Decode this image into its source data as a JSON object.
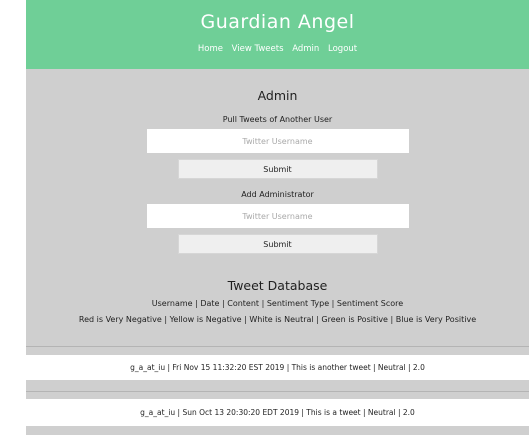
{
  "header": {
    "title": "Guardian Angel",
    "nav": [
      "Home",
      "View Tweets",
      "Admin",
      "Logout"
    ]
  },
  "admin": {
    "title": "Admin",
    "pull": {
      "label": "Pull Tweets of Another User",
      "placeholder": "Twitter Username",
      "submit": "Submit"
    },
    "add": {
      "label": "Add Administrator",
      "placeholder": "Twitter Username",
      "submit": "Submit"
    }
  },
  "database": {
    "title": "Tweet Database",
    "columns": "Username | Date | Content | Sentiment Type | Sentiment Score",
    "legend": "Red is Very Negative | Yellow is Negative | White is Neutral | Green is Positive | Blue is Very Positive",
    "rows": [
      "g_a_at_iu | Fri Nov 15 11:32:20 EST 2019 | This is another tweet | Neutral | 2.0",
      "g_a_at_iu | Sun Oct 13 20:30:20 EDT 2019 | This is a tweet | Neutral | 2.0"
    ]
  },
  "colors": {
    "header": "#6fcf97",
    "background": "#cfcfcf",
    "neutral_row": "#ffffff"
  }
}
